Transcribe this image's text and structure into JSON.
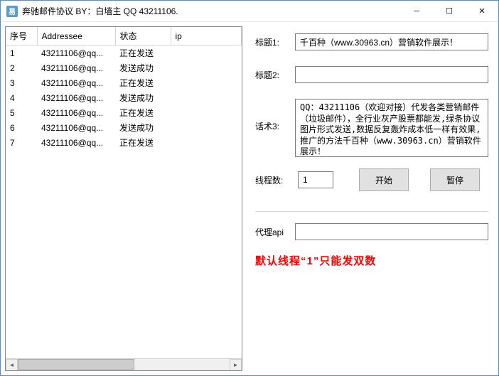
{
  "window": {
    "title": "奔驰邮件协议 BY：白墙主 QQ 43211106.",
    "icon_text": "易"
  },
  "table": {
    "headers": {
      "seq": "序号",
      "addressee": "Addressee",
      "status": "状态",
      "ip": "ip"
    },
    "rows": [
      {
        "seq": "1",
        "addr": "43211106@qq...",
        "status": "正在发送",
        "ip": ""
      },
      {
        "seq": "2",
        "addr": "43211106@qq...",
        "status": "发送成功",
        "ip": ""
      },
      {
        "seq": "3",
        "addr": "43211106@qq...",
        "status": "正在发送",
        "ip": ""
      },
      {
        "seq": "4",
        "addr": "43211106@qq...",
        "status": "发送成功",
        "ip": ""
      },
      {
        "seq": "5",
        "addr": "43211106@qq...",
        "status": "正在发送",
        "ip": ""
      },
      {
        "seq": "6",
        "addr": "43211106@qq...",
        "status": "发送成功",
        "ip": ""
      },
      {
        "seq": "7",
        "addr": "43211106@qq...",
        "status": "正在发送",
        "ip": ""
      }
    ]
  },
  "fields": {
    "title1_label": "标题1:",
    "title1_value": "千百种（www.30963.cn）营销软件展示！",
    "title2_label": "标题2:",
    "title2_value": "",
    "script3_label": "话术3:",
    "script3_value": "QQ：43211106（欢迎对接）代发各类营销邮件（垃圾邮件），全行业灰产股票都能发,绿条协议图片形式发送,数据反复轰炸成本低一样有效果,推广的方法千百种（www.30963.cn）营销软件展示！",
    "thread_label": "线程数:",
    "thread_value": "1",
    "start_label": "开始",
    "pause_label": "暂停",
    "proxy_label": "代理api",
    "proxy_value": ""
  },
  "warning": "默认线程“1”只能发双数"
}
